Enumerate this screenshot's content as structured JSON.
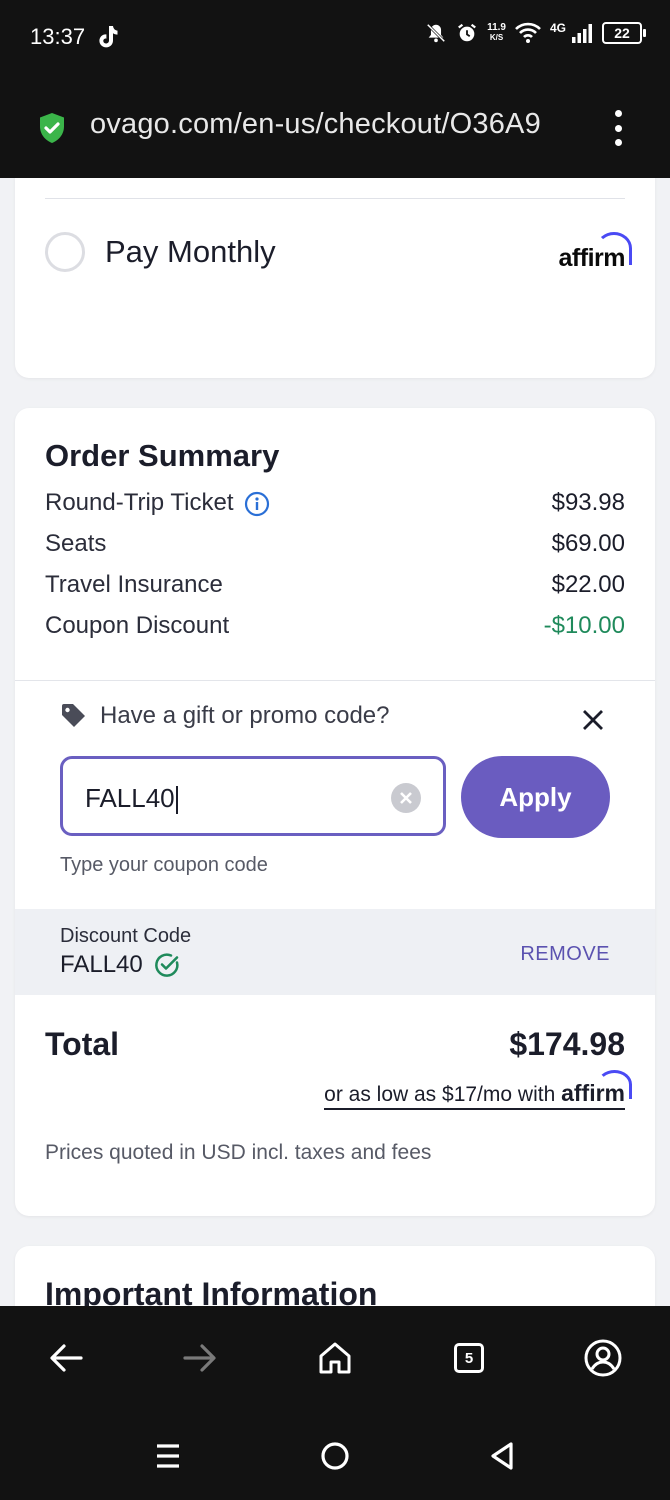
{
  "status": {
    "time": "13:37",
    "net_speed_top": "11.9",
    "net_speed_bottom": "K/S",
    "network": "4G",
    "battery": "22"
  },
  "browser": {
    "url": "ovago.com/en-us/checkout/O36A9"
  },
  "payment": {
    "option_label": "Pay Monthly",
    "provider_logo": "affirm"
  },
  "summary": {
    "title": "Order Summary",
    "rows": [
      {
        "label": "Round-Trip Ticket",
        "value": "$93.98"
      },
      {
        "label": "Seats",
        "value": "$69.00"
      },
      {
        "label": "Travel Insurance",
        "value": "$22.00"
      },
      {
        "label": "Coupon Discount",
        "value": "-$10.00"
      }
    ]
  },
  "promo": {
    "heading": "Have a gift or promo code?",
    "input_value": "FALL40",
    "apply_label": "Apply",
    "helper": "Type your coupon code",
    "discount_label": "Discount Code",
    "discount_code": "FALL40",
    "remove_label": "REMOVE"
  },
  "total": {
    "label": "Total",
    "value": "$174.98",
    "monthly_text": "or as low as $17/mo with",
    "monthly_logo": "affirm",
    "note": "Prices quoted in USD incl. taxes and fees"
  },
  "important": {
    "title": "Important Information"
  },
  "bottom_nav": {
    "tab_count": "5"
  },
  "colors": {
    "accent": "#6a5cc0",
    "green": "#1f8a5b",
    "info_blue": "#2a6fd6",
    "affirm_blue": "#4a4af4",
    "bar_dark": "#121212"
  }
}
